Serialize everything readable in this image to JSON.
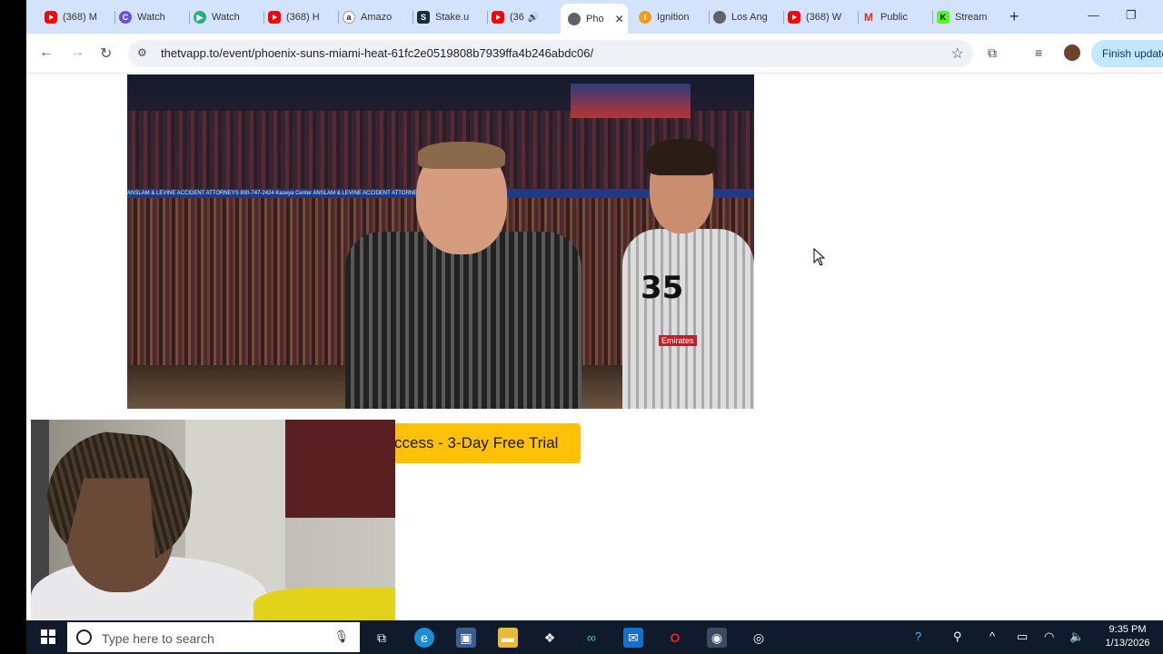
{
  "browser": {
    "tabs": [
      {
        "label": "(368) M",
        "icon": "youtube-icon"
      },
      {
        "label": "Watch",
        "icon": "streaming-icon"
      },
      {
        "label": "Watch",
        "icon": "streaming-icon"
      },
      {
        "label": "(368) H",
        "icon": "youtube-icon"
      },
      {
        "label": "Amazo",
        "icon": "amazon-icon"
      },
      {
        "label": "Stake.u",
        "icon": "stake-icon"
      },
      {
        "label": "(36",
        "icon": "youtube-icon"
      },
      {
        "label": "Pho",
        "icon": "globe-icon",
        "active": true
      },
      {
        "label": "Ignition",
        "icon": "ignition-icon"
      },
      {
        "label": "Los Ang",
        "icon": "globe-icon"
      },
      {
        "label": "(368) W",
        "icon": "youtube-icon"
      },
      {
        "label": "Public",
        "icon": "gmail-icon"
      },
      {
        "label": "Stream",
        "icon": "kick-icon"
      }
    ],
    "url": "thetvapp.to/event/phoenix-suns-miami-heat-61fc2e0519808b7939ffa4b246abdc06/",
    "finish_update_label": "Finish update"
  },
  "page": {
    "cta_label": "ccess - 3-Day Free Trial",
    "video": {
      "banner_text": "ANSLAM & LEVINE   ACCIDENT ATTORNEYS   800-747-2424   Kaseya Center   ANSLAM & LEVINE   ACCIDENT ATTORNEYS   Kaseya Center",
      "jersey_number": "35",
      "sponsor_text": "Emirates"
    }
  },
  "taskbar": {
    "search_placeholder": "Type here to search",
    "time": "9:35 PM",
    "date": "1/13/2026"
  },
  "colors": {
    "tabstrip": "#d3e3fd",
    "cta": "#ffc107",
    "taskbar": "#0f1a2a",
    "finish_update": "#c2e7ff"
  }
}
